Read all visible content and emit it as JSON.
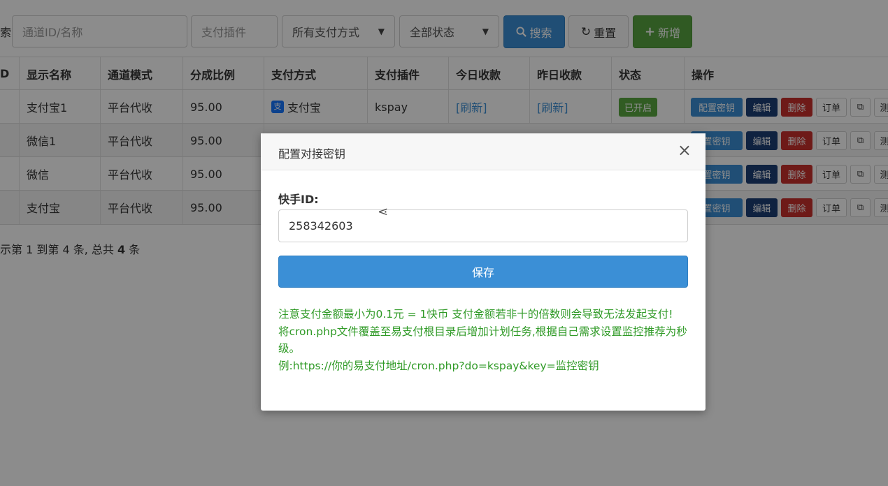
{
  "toolbar": {
    "search_label": "索",
    "channel_placeholder": "通道ID/名称",
    "plugin_placeholder": "支付插件",
    "paytype_select": "所有支付方式",
    "status_select": "全部状态",
    "search_btn": "搜索",
    "reset_btn": "重置",
    "add_btn": "新增"
  },
  "table": {
    "headers": [
      "D",
      "显示名称",
      "通道模式",
      "分成比例",
      "支付方式",
      "支付插件",
      "今日收款",
      "昨日收款",
      "状态",
      "操作"
    ],
    "rows": [
      {
        "name": "支付宝1",
        "mode": "平台代收",
        "ratio": "95.00",
        "paytype": "支付宝",
        "plugin": "kspay",
        "today": "[刷新]",
        "yesterday": "[刷新]",
        "status": "已开启",
        "op_key": "配置密钥"
      },
      {
        "name": "微信1",
        "mode": "平台代收",
        "ratio": "95.00",
        "op_key": "置密钥"
      },
      {
        "name": "微信",
        "mode": "平台代收",
        "ratio": "95.00",
        "op_key": "置密钥"
      },
      {
        "name": "支付宝",
        "mode": "平台代收",
        "ratio": "95.00",
        "op_key": "置密钥"
      }
    ],
    "op_edit": "编辑",
    "op_delete": "删除",
    "op_order": "订单",
    "op_test": "测",
    "footer_prefix": "示第 1 到第 4 条, 总共 ",
    "footer_total": "4",
    "footer_suffix": " 条"
  },
  "modal": {
    "title": "配置对接密钥",
    "close": "×",
    "field_label": "快手ID:",
    "field_value": "258342603",
    "save": "保存",
    "notes": [
      "注意支付金额最小为0.1元 = 1快币 支付金额若非十的倍数则会导致无法发起支付!",
      "将cron.php文件覆盖至易支付根目录后增加计划任务,根据自己需求设置监控推荐为秒级。",
      "例:https://你的易支付地址/cron.php?do=kspay&key=监控密钥"
    ]
  },
  "colors": {
    "primary": "#3b8fd6",
    "success": "#58a540",
    "danger": "#c9302c",
    "dark_blue": "#1d3f75",
    "note_green": "#2f9a26"
  }
}
